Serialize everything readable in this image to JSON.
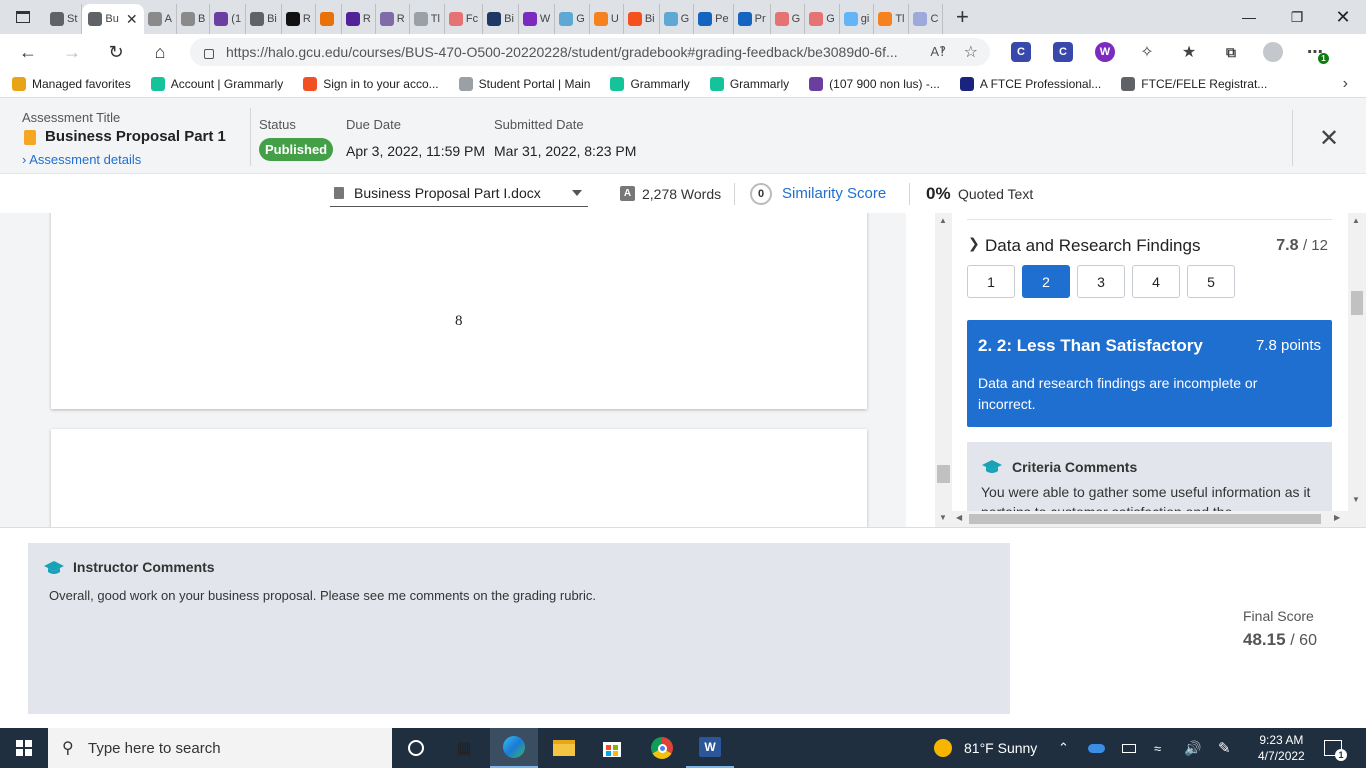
{
  "browser": {
    "tabs": [
      {
        "label": "St",
        "icon": "document-icon",
        "color": "#5f6368"
      },
      {
        "label": "Bu",
        "icon": "document-icon",
        "color": "#5f6368",
        "active": true
      },
      {
        "label": "A",
        "icon": "pen-icon",
        "color": "#8a8a8a"
      },
      {
        "label": "B",
        "icon": "pen-icon",
        "color": "#8a8a8a"
      },
      {
        "label": "(1",
        "icon": "mail-icon",
        "color": "#6b3fa0"
      },
      {
        "label": "Bi",
        "icon": "file-icon",
        "color": "#5f6368"
      },
      {
        "label": "R",
        "icon": "r-icon",
        "color": "#111111"
      },
      {
        "label": "",
        "icon": "flame-icon",
        "color": "#e8710a"
      },
      {
        "label": "R",
        "icon": "shield-icon",
        "color": "#522398"
      },
      {
        "label": "R",
        "icon": "shield-icon",
        "color": "#7e6ba8"
      },
      {
        "label": "Tl",
        "icon": "doc-icon",
        "color": "#9aa0a6"
      },
      {
        "label": "Fc",
        "icon": "pdf-icon",
        "color": "#e57373"
      },
      {
        "label": "Bi",
        "icon": "circle-icon",
        "color": "#1f3864"
      },
      {
        "label": "W",
        "icon": "w-icon",
        "color": "#7b2cbf"
      },
      {
        "label": "G",
        "icon": "g-icon",
        "color": "#5fa8d3"
      },
      {
        "label": "U",
        "icon": "c-icon",
        "color": "#f5821f"
      },
      {
        "label": "Bi",
        "icon": "k-icon",
        "color": "#f4511e"
      },
      {
        "label": "G",
        "icon": "g-icon",
        "color": "#5fa8d3"
      },
      {
        "label": "Pe",
        "icon": "p-icon",
        "color": "#1565c0"
      },
      {
        "label": "Pr",
        "icon": "p-icon",
        "color": "#1565c0"
      },
      {
        "label": "G",
        "icon": "g-icon",
        "color": "#e57373"
      },
      {
        "label": "G",
        "icon": "g-icon",
        "color": "#e57373"
      },
      {
        "label": "gi",
        "icon": "b-icon",
        "color": "#64b5f6"
      },
      {
        "label": "Tl",
        "icon": "c-icon",
        "color": "#f5821f"
      },
      {
        "label": "C",
        "icon": "c-icon",
        "color": "#9fa8da"
      }
    ],
    "url": "https://halo.gcu.edu/courses/BUS-470-O500-20220228/student/gradebook#grading-feedback/be3089d0-6f...",
    "extensions": [
      {
        "label": "C",
        "color": "#3949ab"
      },
      {
        "label": "C",
        "color": "#3949ab"
      },
      {
        "label": "W",
        "color": "#7b2cbf"
      }
    ],
    "ext_badge": "1"
  },
  "bookmarks": [
    {
      "label": "Managed favorites",
      "color": "#e8a317"
    },
    {
      "label": "Account | Grammarly",
      "color": "#15c39a"
    },
    {
      "label": "Sign in to your acco...",
      "color": "#f25022"
    },
    {
      "label": "Student Portal | Main",
      "color": "#9aa0a6"
    },
    {
      "label": "Grammarly",
      "color": "#15c39a"
    },
    {
      "label": "Grammarly",
      "color": "#15c39a"
    },
    {
      "label": "(107 900 non lus) -...",
      "color": "#6b3fa0"
    },
    {
      "label": "A FTCE Professional...",
      "color": "#1a237e"
    },
    {
      "label": "FTCE/FELE Registrat...",
      "color": "#5f6368"
    }
  ],
  "assessment": {
    "title_label": "Assessment Title",
    "title": "Business Proposal Part 1",
    "details_link": "Assessment details",
    "status_label": "Status",
    "status": "Published",
    "due_label": "Due Date",
    "due": "Apr 3, 2022, 11:59 PM",
    "submitted_label": "Submitted Date",
    "submitted": "Mar 31, 2022, 8:23 PM"
  },
  "doc_toolbar": {
    "file": "Business Proposal Part I.docx",
    "words": "2,278 Words",
    "similarity_count": "0",
    "similarity_label": "Similarity Score",
    "quoted_pct": "0%",
    "quoted_label": "Quoted Text"
  },
  "document": {
    "page_number": "8"
  },
  "rubric": {
    "criterion": "Data and Research Findings",
    "score": "7.8",
    "max": "/ 12",
    "levels": [
      "1",
      "2",
      "3",
      "4",
      "5"
    ],
    "selected_level": 2,
    "level_title": "2. 2: Less Than Satisfactory",
    "level_points": "7.8 points",
    "level_desc": "Data and research findings are incomplete or incorrect.",
    "comments_title": "Criteria Comments",
    "comments_text": "You were able to gather some useful information as it pertains to customer satisfaction and the"
  },
  "instructor": {
    "title": "Instructor Comments",
    "text": "Overall, good work on your business proposal. Please see me comments on the grading rubric."
  },
  "final": {
    "label": "Final Score",
    "score": "48.15",
    "max": "/ 60"
  },
  "taskbar": {
    "search_placeholder": "Type here to search",
    "weather": "81°F  Sunny",
    "time": "9:23 AM",
    "date": "4/7/2022",
    "notif_count": "1"
  }
}
